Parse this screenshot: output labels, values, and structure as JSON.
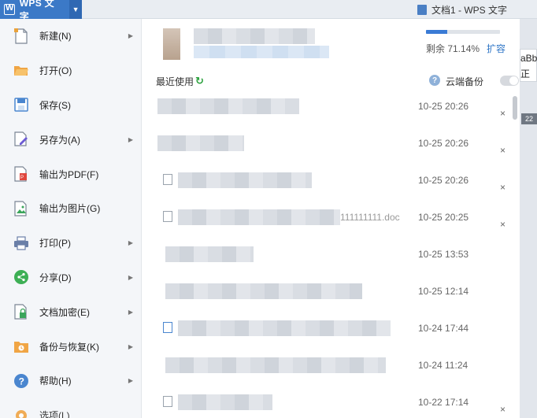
{
  "titlebar": {
    "app_name": "WPS 文字",
    "doc_title": "文档1 - WPS 文字"
  },
  "menu": {
    "items": [
      {
        "label": "新建(N)",
        "icon": "new-doc-icon",
        "arrow": true
      },
      {
        "label": "打开(O)",
        "icon": "open-folder-icon",
        "arrow": false
      },
      {
        "label": "保存(S)",
        "icon": "save-icon",
        "arrow": false
      },
      {
        "label": "另存为(A)",
        "icon": "save-as-icon",
        "arrow": true
      },
      {
        "label": "输出为PDF(F)",
        "icon": "pdf-export-icon",
        "arrow": false
      },
      {
        "label": "输出为图片(G)",
        "icon": "image-export-icon",
        "arrow": false
      },
      {
        "label": "打印(P)",
        "icon": "print-icon",
        "arrow": true
      },
      {
        "label": "分享(D)",
        "icon": "share-icon",
        "arrow": true
      },
      {
        "label": "文档加密(E)",
        "icon": "lock-doc-icon",
        "arrow": true
      },
      {
        "label": "备份与恢复(K)",
        "icon": "backup-icon",
        "arrow": true
      },
      {
        "label": "帮助(H)",
        "icon": "help-icon",
        "arrow": true
      },
      {
        "label": "选项(L)",
        "icon": "gear-icon",
        "arrow": false
      }
    ]
  },
  "storage": {
    "remaining_text": "剩余 71.14%",
    "expand_label": "扩容",
    "used_fraction": 0.29
  },
  "recent": {
    "label": "最近使用",
    "cloud_backup_label": "云端备份",
    "help_glyph": "?"
  },
  "files": [
    {
      "date": "10-25 20:26",
      "name": ""
    },
    {
      "date": "10-25 20:26",
      "name": ""
    },
    {
      "date": "10-25 20:26",
      "name": ""
    },
    {
      "date": "10-25 20:25",
      "name": "111111111.doc"
    },
    {
      "date": "10-25 13:53",
      "name": ""
    },
    {
      "date": "10-25 12:14",
      "name": ""
    },
    {
      "date": "10-24 17:44",
      "name": ""
    },
    {
      "date": "10-24 11:24",
      "name": ""
    },
    {
      "date": "10-22 17:14",
      "name": ""
    }
  ],
  "close_glyph": "×",
  "docedge": {
    "style_text_1": "aBb",
    "style_text_2": "正",
    "ruler_text": "22"
  },
  "colors": {
    "accent": "#3b79c7",
    "link": "#2e75c6",
    "refresh": "#2aa03c"
  }
}
